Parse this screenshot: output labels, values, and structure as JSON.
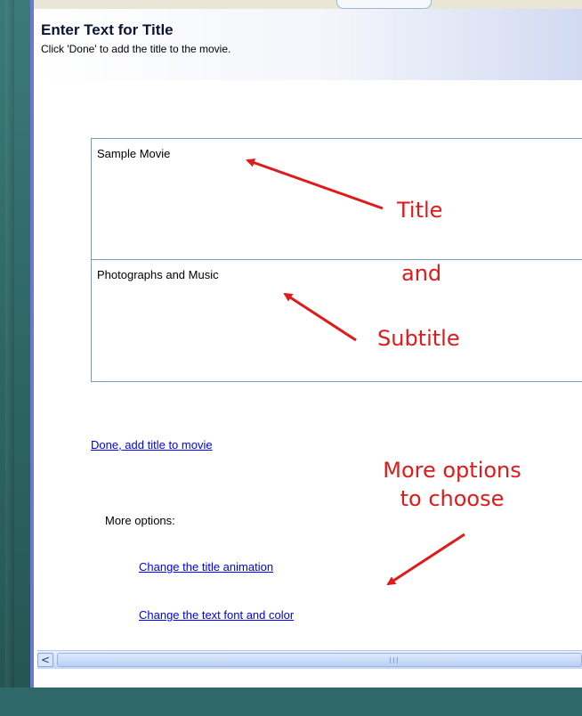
{
  "header": {
    "title": "Enter Text for Title",
    "subtitle": "Click 'Done' to add the title to the movie."
  },
  "title_box": {
    "value": "Sample Movie"
  },
  "subtitle_box": {
    "value": "Photographs and Music"
  },
  "links": {
    "done": "Done, add title to movie",
    "more_options_label": "More options:",
    "change_animation": "Change the title animation",
    "change_font": "Change the text font and color"
  },
  "annotations": {
    "title": "Title",
    "and": "and",
    "subtitle": "Subtitle",
    "more_options_line1": "More options",
    "more_options_line2": "to choose"
  },
  "scrollbar": {
    "left_arrow": "<",
    "grip": "III"
  },
  "colors": {
    "annotation": "#e01a1a",
    "link": "#0000ee",
    "window_border": "#6b79d0"
  }
}
